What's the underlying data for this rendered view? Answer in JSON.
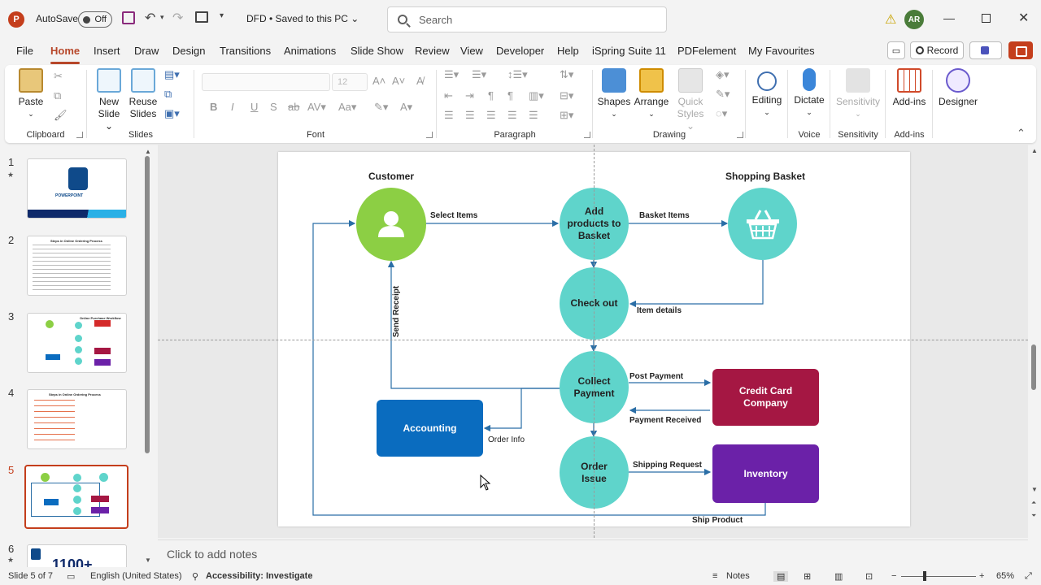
{
  "titlebar": {
    "autosave_label": "AutoSave",
    "autosave_state": "Off",
    "document_title": "DFD • Saved to this PC",
    "search_placeholder": "Search",
    "user_initials": "AR",
    "app_logo": "P"
  },
  "menu": {
    "tabs": [
      "File",
      "Home",
      "Insert",
      "Draw",
      "Design",
      "Transitions",
      "Animations",
      "Slide Show",
      "Review",
      "View",
      "Developer",
      "Help",
      "iSpring Suite 11",
      "PDFelement",
      "My Favourites"
    ],
    "active_tab": "Home",
    "record_label": "Record"
  },
  "ribbon": {
    "clipboard": {
      "paste": "Paste",
      "label": "Clipboard"
    },
    "slides": {
      "new_slide_1": "New",
      "new_slide_2": "Slide",
      "reuse_1": "Reuse",
      "reuse_2": "Slides",
      "label": "Slides"
    },
    "font": {
      "size": "12",
      "label": "Font"
    },
    "paragraph": {
      "label": "Paragraph"
    },
    "drawing": {
      "shapes": "Shapes",
      "arrange": "Arrange",
      "quick_styles_1": "Quick",
      "quick_styles_2": "Styles",
      "label": "Drawing"
    },
    "editing": {
      "label": "Editing"
    },
    "voice": {
      "dictate": "Dictate",
      "label": "Voice"
    },
    "sensitivity": {
      "button": "Sensitivity",
      "label": "Sensitivity"
    },
    "addins": {
      "button": "Add-ins",
      "label": "Add-ins"
    },
    "designer": {
      "button": "Designer"
    }
  },
  "thumbnails": {
    "numbers": [
      "1",
      "2",
      "3",
      "4",
      "5",
      "6"
    ],
    "active": "5",
    "thumb4_title": "Steps in Online Ordering Process",
    "thumb2_title": "Steps in Online Ordering Process",
    "thumb3_title": "Online Purchase Workflow",
    "thumb1_title": "POWERPOINT",
    "thumb6_text": "1100+"
  },
  "diagram": {
    "headings": {
      "customer": "Customer",
      "basket": "Shopping Basket"
    },
    "nodes": {
      "add_products": "Add products to Basket",
      "checkout": "Check out",
      "collect_payment": "Collect Payment",
      "order_issue": "Order Issue",
      "accounting": "Accounting",
      "credit_card": "Credit Card Company",
      "inventory": "Inventory"
    },
    "labels": {
      "select_items": "Select Items",
      "basket_items": "Basket Items",
      "item_details": "Item details",
      "send_receipt": "Send Receipt",
      "post_payment": "Post Payment",
      "payment_received": "Payment Received",
      "order_info": "Order Info",
      "shipping_request": "Shipping Request",
      "ship_product": "Ship Product"
    },
    "colors": {
      "customer": "#8ccf44",
      "teal": "#5fd4cb",
      "accounting": "#0a6cbf",
      "credit_card": "#a51743",
      "inventory": "#6b21a8",
      "arrows": "#2a6ea6"
    }
  },
  "notes": {
    "placeholder": "Click to add notes"
  },
  "status": {
    "slide_info": "Slide 5 of 7",
    "language": "English (United States)",
    "accessibility": "Accessibility: Investigate",
    "notes_btn": "Notes",
    "zoom": "65%"
  }
}
